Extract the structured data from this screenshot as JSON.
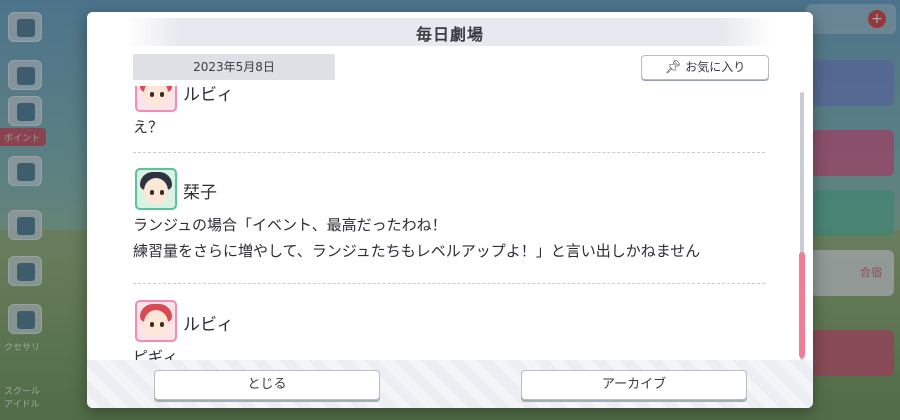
{
  "dialog": {
    "title": "毎日劇場",
    "date": "2023年5月8日",
    "favorite_label": "お気に入り",
    "favorite_icon": "pin-icon"
  },
  "entries": [
    {
      "speaker": "ルビィ",
      "lines": [
        "え？"
      ]
    },
    {
      "speaker": "栞子",
      "lines": [
        "ランジュの場合「イベント、最高だったわね！",
        "練習量をさらに増やして、ランジュたちもレベルアップよ！」と言い出しかねません"
      ]
    },
    {
      "speaker": "ルビィ",
      "lines": [
        "ピギィ……"
      ]
    }
  ],
  "footer": {
    "close_label": "とじる",
    "archive_label": "アーカイブ"
  },
  "background": {
    "left_tag": "ポイント",
    "left_label_1": "クセサリ",
    "left_label_2": "スクール アイドル",
    "right_label": "合宿"
  },
  "colors": {
    "accent_pink": "#f07e96",
    "panel": "#ffffff",
    "date_tab": "#dfe0e6"
  }
}
